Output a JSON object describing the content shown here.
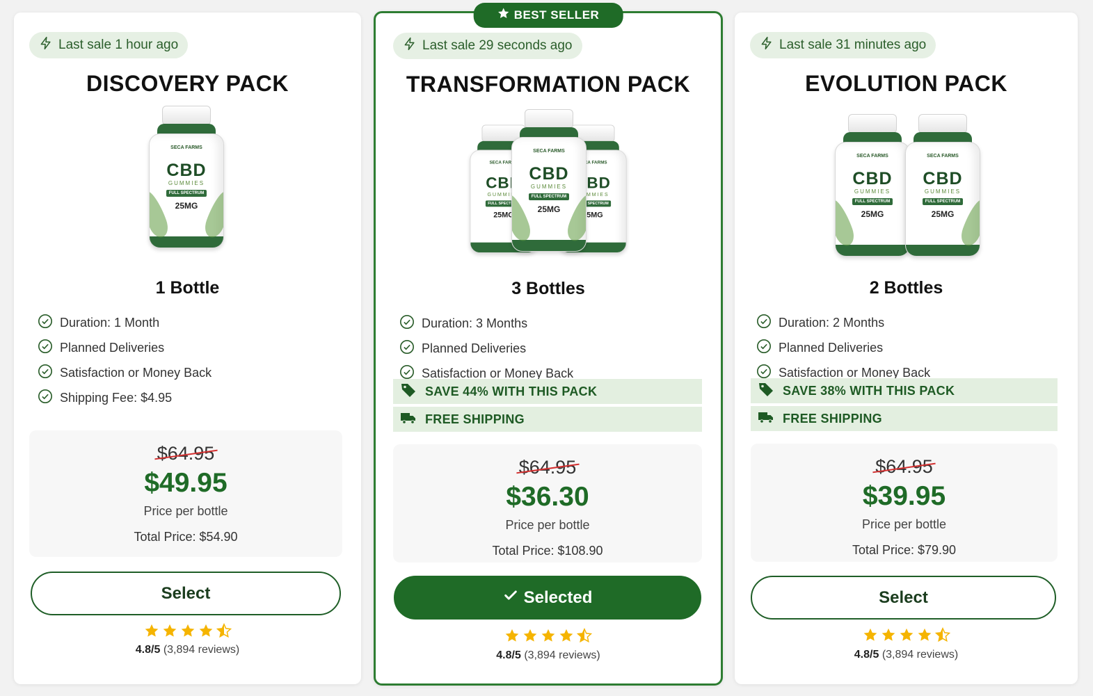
{
  "colors": {
    "brand_green": "#1f6b27",
    "light_green": "#e3efe0",
    "star": "#f5b400",
    "strike": "#d32f2f"
  },
  "cards": [
    {
      "last_sale": "Last sale 1 hour ago",
      "title": "DISCOVERY PACK",
      "bottle_count": 1,
      "bottles_label": "1 Bottle",
      "features": [
        "Duration: 1 Month",
        "Planned Deliveries",
        "Satisfaction or Money Back",
        "Shipping Fee: $4.95"
      ],
      "old_price": "$64.95",
      "price": "$49.95",
      "per_bottle": "Price per bottle",
      "total": "Total Price: $54.90",
      "button": "Select",
      "rating_score": "4.8/5",
      "rating_reviews": "(3,894 reviews)"
    },
    {
      "badge": "BEST SELLER",
      "last_sale": "Last sale 29 seconds ago",
      "title": "TRANSFORMATION PACK",
      "bottle_count": 3,
      "bottles_label": "3 Bottles",
      "features": [
        "Duration: 3 Months",
        "Planned Deliveries",
        "Satisfaction or Money Back"
      ],
      "promo_save": "SAVE 44% WITH THIS PACK",
      "promo_shipping": "FREE SHIPPING",
      "old_price": "$64.95",
      "price": "$36.30",
      "per_bottle": "Price per bottle",
      "total": "Total Price: $108.90",
      "button": "Selected",
      "rating_score": "4.8/5",
      "rating_reviews": "(3,894 reviews)"
    },
    {
      "last_sale": "Last sale 31 minutes ago",
      "title": "EVOLUTION PACK",
      "bottle_count": 2,
      "bottles_label": "2 Bottles",
      "features": [
        "Duration: 2 Months",
        "Planned Deliveries",
        "Satisfaction or Money Back"
      ],
      "promo_save": "SAVE 38% WITH THIS PACK",
      "promo_shipping": "FREE SHIPPING",
      "old_price": "$64.95",
      "price": "$39.95",
      "per_bottle": "Price per bottle",
      "total": "Total Price: $79.90",
      "button": "Select",
      "rating_score": "4.8/5",
      "rating_reviews": "(3,894 reviews)"
    }
  ],
  "bottle_label": {
    "brand": "SECA FARMS",
    "name": "CBD",
    "sub": "GUMMIES",
    "spectrum": "FULL SPECTRUM",
    "dose": "25MG"
  },
  "rating": {
    "stars": 4.5,
    "max": 5
  }
}
